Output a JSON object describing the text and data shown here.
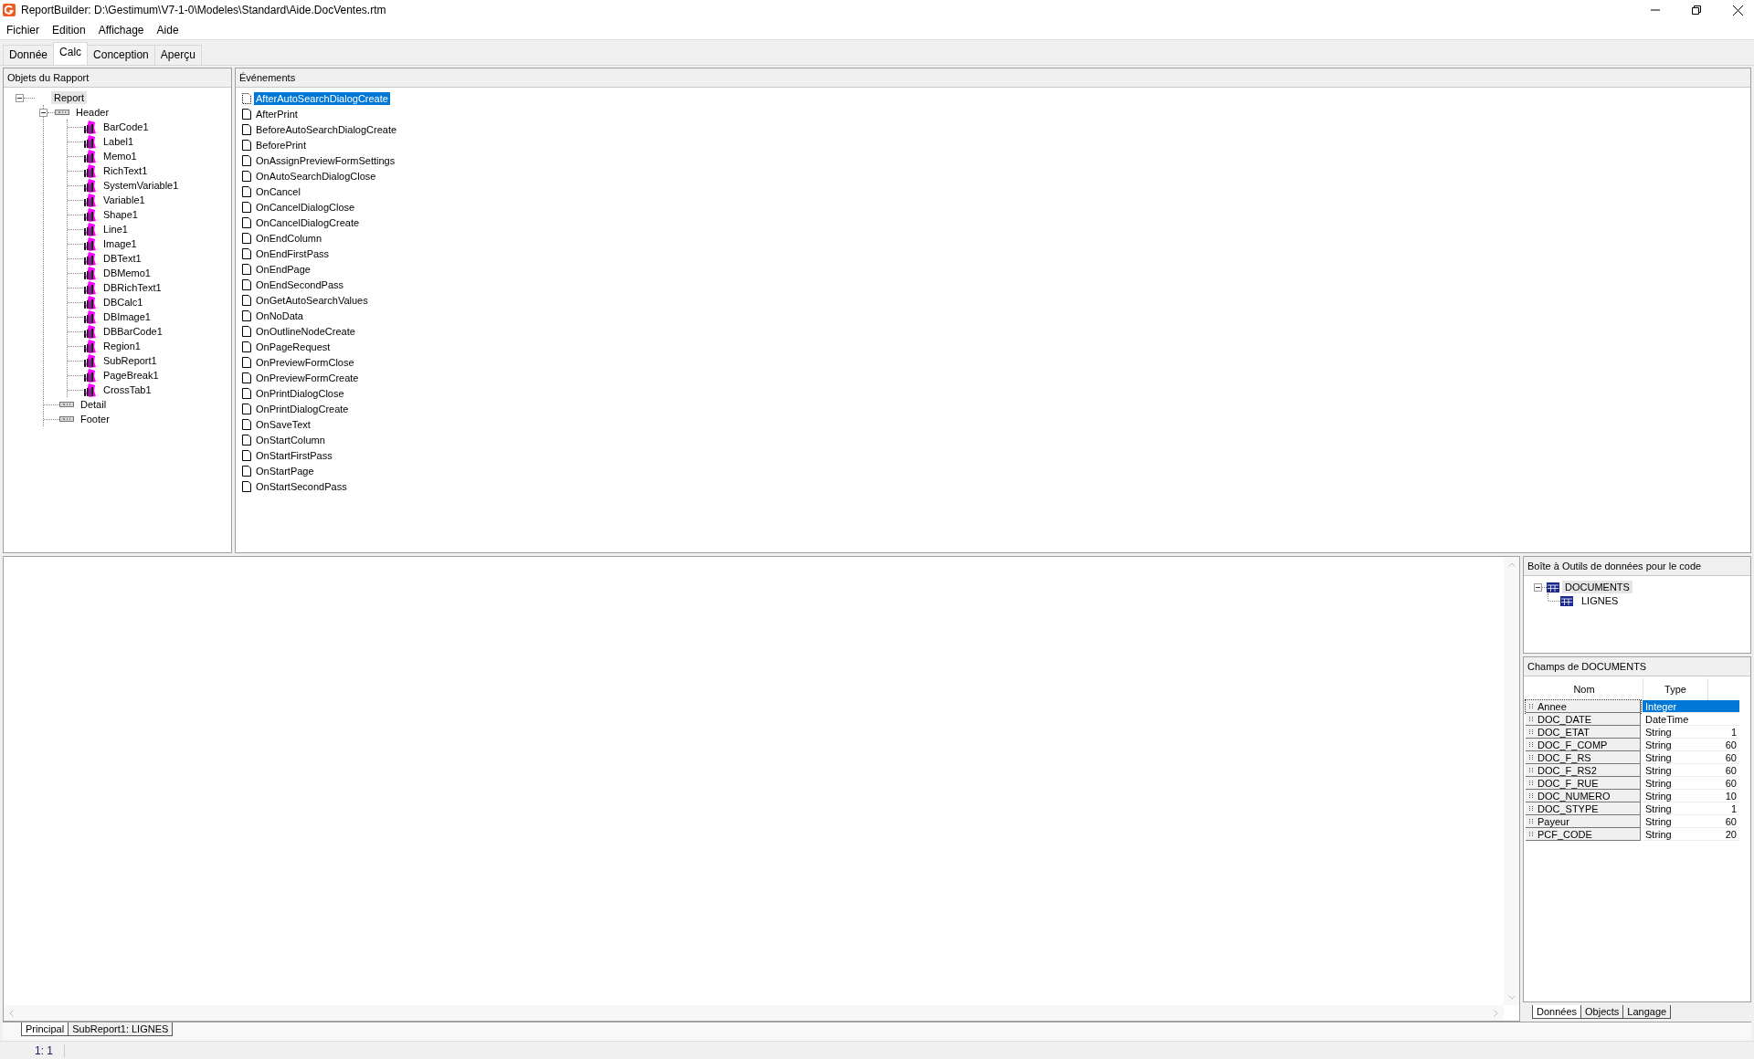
{
  "window": {
    "title": "ReportBuilder: D:\\Gestimum\\V7-1-0\\Modeles\\Standard\\Aide.DocVentes.rtm"
  },
  "menu": [
    "Fichier",
    "Edition",
    "Affichage",
    "Aide"
  ],
  "tabs": [
    {
      "label": "Donnée",
      "selected": false
    },
    {
      "label": "Calc",
      "selected": true
    },
    {
      "label": "Conception",
      "selected": false
    },
    {
      "label": "Aperçu",
      "selected": false
    }
  ],
  "objects_panel": {
    "title": "Objets du Rapport",
    "tree": [
      {
        "label": "Report",
        "selected": true,
        "expanded": true,
        "children": [
          {
            "label": "Header",
            "kind": "band",
            "selected": false,
            "expanded": true,
            "children": [
              {
                "label": "BarCode1",
                "kind": "component",
                "selected": false
              },
              {
                "label": "Label1",
                "kind": "component",
                "selected": false
              },
              {
                "label": "Memo1",
                "kind": "component",
                "selected": false
              },
              {
                "label": "RichText1",
                "kind": "component",
                "selected": false
              },
              {
                "label": "SystemVariable1",
                "kind": "component",
                "selected": false
              },
              {
                "label": "Variable1",
                "kind": "component",
                "selected": false
              },
              {
                "label": "Shape1",
                "kind": "component",
                "selected": false
              },
              {
                "label": "Line1",
                "kind": "component",
                "selected": false
              },
              {
                "label": "Image1",
                "kind": "component",
                "selected": false
              },
              {
                "label": "DBText1",
                "kind": "component",
                "selected": false
              },
              {
                "label": "DBMemo1",
                "kind": "component",
                "selected": false
              },
              {
                "label": "DBRichText1",
                "kind": "component",
                "selected": false
              },
              {
                "label": "DBCalc1",
                "kind": "component",
                "selected": false
              },
              {
                "label": "DBImage1",
                "kind": "component",
                "selected": false
              },
              {
                "label": "DBBarCode1",
                "kind": "component",
                "selected": false
              },
              {
                "label": "Region1",
                "kind": "component",
                "selected": false
              },
              {
                "label": "SubReport1",
                "kind": "component",
                "selected": false
              },
              {
                "label": "PageBreak1",
                "kind": "component",
                "selected": false
              },
              {
                "label": "CrossTab1",
                "kind": "component",
                "selected": false
              }
            ]
          },
          {
            "label": "Detail",
            "kind": "band",
            "selected": false
          },
          {
            "label": "Footer",
            "kind": "band",
            "selected": false
          }
        ]
      }
    ]
  },
  "events_panel": {
    "title": "Événements",
    "events": [
      {
        "label": "AfterAutoSearchDialogCreate",
        "selected": true
      },
      {
        "label": "AfterPrint",
        "selected": false
      },
      {
        "label": "BeforeAutoSearchDialogCreate",
        "selected": false
      },
      {
        "label": "BeforePrint",
        "selected": false
      },
      {
        "label": "OnAssignPreviewFormSettings",
        "selected": false
      },
      {
        "label": "OnAutoSearchDialogClose",
        "selected": false
      },
      {
        "label": "OnCancel",
        "selected": false
      },
      {
        "label": "OnCancelDialogClose",
        "selected": false
      },
      {
        "label": "OnCancelDialogCreate",
        "selected": false
      },
      {
        "label": "OnEndColumn",
        "selected": false
      },
      {
        "label": "OnEndFirstPass",
        "selected": false
      },
      {
        "label": "OnEndPage",
        "selected": false
      },
      {
        "label": "OnEndSecondPass",
        "selected": false
      },
      {
        "label": "OnGetAutoSearchValues",
        "selected": false
      },
      {
        "label": "OnNoData",
        "selected": false
      },
      {
        "label": "OnOutlineNodeCreate",
        "selected": false
      },
      {
        "label": "OnPageRequest",
        "selected": false
      },
      {
        "label": "OnPreviewFormClose",
        "selected": false
      },
      {
        "label": "OnPreviewFormCreate",
        "selected": false
      },
      {
        "label": "OnPrintDialogClose",
        "selected": false
      },
      {
        "label": "OnPrintDialogCreate",
        "selected": false
      },
      {
        "label": "OnSaveText",
        "selected": false
      },
      {
        "label": "OnStartColumn",
        "selected": false
      },
      {
        "label": "OnStartFirstPass",
        "selected": false
      },
      {
        "label": "OnStartPage",
        "selected": false
      },
      {
        "label": "OnStartSecondPass",
        "selected": false
      }
    ]
  },
  "toolbox": {
    "title": "Boîte à Outils de données pour le code",
    "tree": [
      {
        "label": "DOCUMENTS",
        "selected": true,
        "expanded": true,
        "children": [
          {
            "label": "LIGNES",
            "selected": false
          }
        ]
      }
    ]
  },
  "fields": {
    "title": "Champs de DOCUMENTS",
    "columns": [
      "Nom",
      "Type"
    ],
    "rows": [
      {
        "name": "Annee",
        "type": "Integer",
        "selected": true
      },
      {
        "name": "DOC_DATE",
        "type": "DateTime",
        "selected": false
      },
      {
        "name": "DOC_ETAT",
        "type": "String",
        "size": "1",
        "selected": false
      },
      {
        "name": "DOC_F_COMP",
        "type": "String",
        "size": "60",
        "selected": false
      },
      {
        "name": "DOC_F_RS",
        "type": "String",
        "size": "60",
        "selected": false
      },
      {
        "name": "DOC_F_RS2",
        "type": "String",
        "size": "60",
        "selected": false
      },
      {
        "name": "DOC_F_RUE",
        "type": "String",
        "size": "60",
        "selected": false
      },
      {
        "name": "DOC_NUMERO",
        "type": "String",
        "size": "10",
        "selected": false
      },
      {
        "name": "DOC_STYPE",
        "type": "String",
        "size": "1",
        "selected": false
      },
      {
        "name": "Payeur",
        "type": "String",
        "size": "60",
        "selected": false
      },
      {
        "name": "PCF_CODE",
        "type": "String",
        "size": "20",
        "selected": false
      }
    ]
  },
  "toolbox_tabs": [
    {
      "label": "Données",
      "selected": true
    },
    {
      "label": "Objects",
      "selected": false
    },
    {
      "label": "Langage",
      "selected": false
    }
  ],
  "editor_tabs": [
    {
      "label": "Principal",
      "selected": true
    },
    {
      "label": "SubReport1: LIGNES",
      "selected": false
    }
  ],
  "status_bar": [
    "1: 1"
  ]
}
